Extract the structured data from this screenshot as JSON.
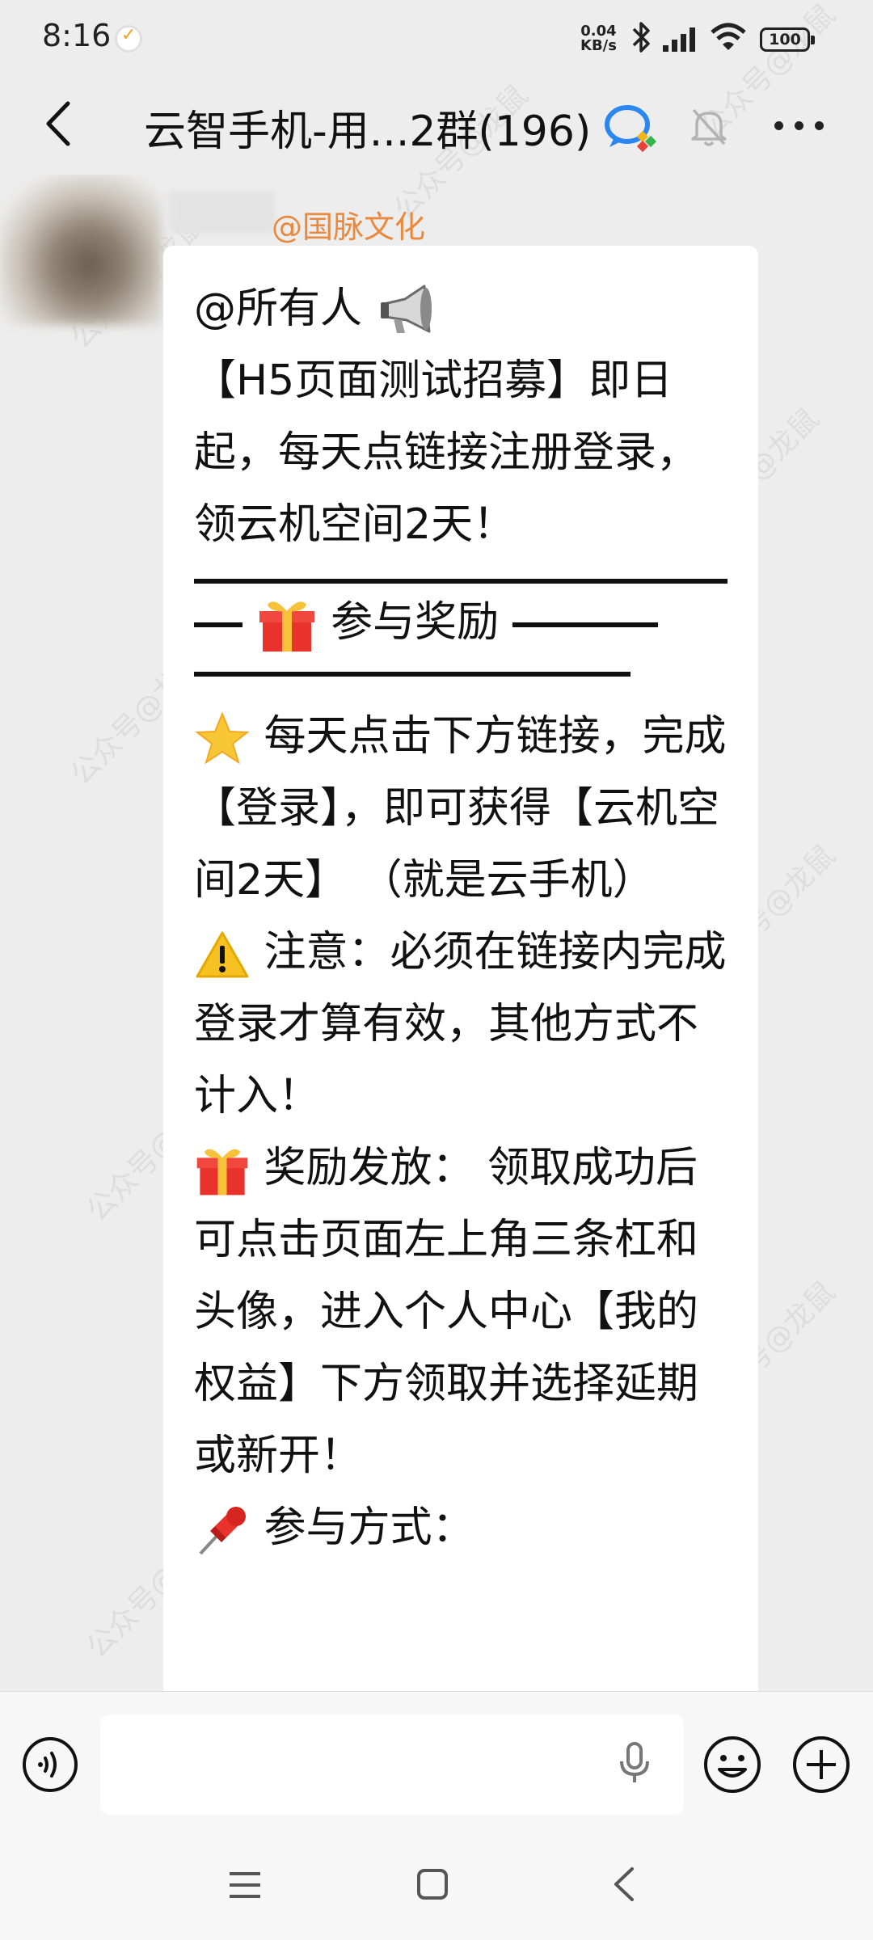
{
  "status_bar": {
    "time": "8:16",
    "net_speed_value": "0.04",
    "net_speed_unit": "KB/s",
    "battery": "100"
  },
  "header": {
    "title": "云智手机-用...2群(196)"
  },
  "message": {
    "sender_mention": "@国脉文化",
    "lines": {
      "l1": "@所有人",
      "l2": "【H5页面测试招募】即日起，每天点链接注册登录，领云机空间2天！",
      "l3": "参与奖励",
      "l4": "每天点击下方链接，完成【登录】，即可获得【云机空间2天】 （就是云手机）",
      "l5": "注意：必须在链接内完成登录才算有效，其他方式不计入！",
      "l6": "奖励发放： 领取成功后可点击页面左上角三条杠和头像，进入个人中心【我的权益】下方领取并选择延期或新开！",
      "l7": "参与方式："
    }
  },
  "watermark_text": "公众号@龙鼠",
  "input_bar": {
    "placeholder": ""
  }
}
